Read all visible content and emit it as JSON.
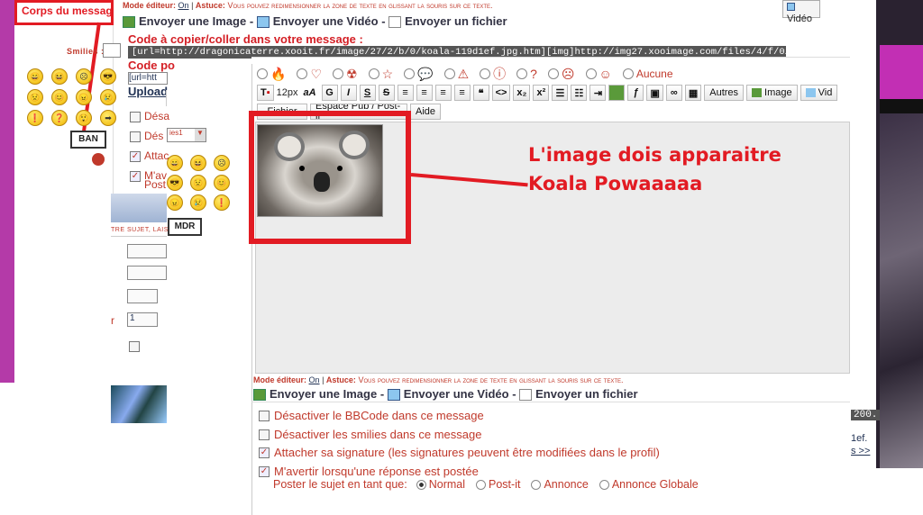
{
  "back_window": {
    "title_partial": "Corps du messag",
    "smilies_label": "Smilies :",
    "ban_label": "BAN",
    "mdr_label": "MDR",
    "smilies": [
      "😄",
      "😆",
      "☹",
      "😎",
      "😟",
      "😊",
      "😠",
      "😢",
      "❗",
      "❓",
      "😲",
      "➡"
    ]
  },
  "mid_window": {
    "mode_label": "Mode éditeur:",
    "mode_value": "On",
    "tip_label": "Astuce:",
    "tip_text": "Vous pouvez redimensionner la zone de texte en glissant la souris sur ce texte.",
    "send_image": "Envoyer une Image",
    "send_video": "Envoyer une Vidéo",
    "send_file": "Envoyer un fichier",
    "code_label": "Code à copier/coller dans votre message :",
    "code_value": "[url=http://dragonicaterre.xooit.fr/image/27/2/b/0/koala-119d1ef.jpg.htm][img]http://img27.xooimage.com/files/4/f/0/koala-119d200.",
    "code_label2_partial": "Code po",
    "code_value2_partial": "[url=htt",
    "upload_partial": "Upload",
    "video_button": "Vidéo"
  },
  "left_partial": {
    "checks": [
      {
        "label": "Désa",
        "checked": false
      },
      {
        "label": "Dés",
        "checked": false
      },
      {
        "label": "Attac",
        "checked": true
      },
      {
        "label": "M'av",
        "checked": true
      }
    ],
    "post_label": "Post",
    "select_value": "ies1",
    "hint_partial": "TRE SUJET, LAIS",
    "field_value": "1",
    "side_label": "r"
  },
  "editor": {
    "radio_none": "Aucune",
    "font_size": "12px",
    "toolbar": {
      "bold": "G",
      "italic": "I",
      "underline": "S",
      "strike": "S",
      "quote": "❝",
      "code": "<>",
      "sub": "x₂",
      "sup": "x²",
      "more": "Autres",
      "image": "Image",
      "video": "Vid",
      "fichier": "Fichier",
      "post_it": "Espace Pub / Post-it",
      "aide": "Aide"
    },
    "mode_label": "Mode éditeur:",
    "mode_value": "On",
    "tip_label": "Astuce:",
    "tip_text": "Vous pouvez redimensionner la zone de texte en glissant la souris sur ce texte.",
    "send_image": "Envoyer une Image",
    "send_video": "Envoyer une Vidéo",
    "send_file": "Envoyer un fichier",
    "options": [
      {
        "label": "Désactiver le BBCode dans ce message",
        "checked": false
      },
      {
        "label": "Désactiver les smilies dans ce message",
        "checked": false
      },
      {
        "label": "Attacher sa signature (les signatures peuvent être modifiées dans le profil)",
        "checked": true
      },
      {
        "label": "M'avertir lorsqu'une réponse est postée",
        "checked": true
      }
    ],
    "poster_label": "Poster le sujet en tant que:",
    "poster_options": [
      {
        "label": "Normal",
        "selected": true
      },
      {
        "label": "Post-it",
        "selected": false
      },
      {
        "label": "Annonce",
        "selected": false
      },
      {
        "label": "Annonce Globale",
        "selected": false
      }
    ]
  },
  "annotation": {
    "line1": "L'image dois apparaitre",
    "line2": "Koala Powaaaaa"
  },
  "right_partial": {
    "v1": "200.",
    "v2": "1ef.",
    "v3": "s >>"
  }
}
